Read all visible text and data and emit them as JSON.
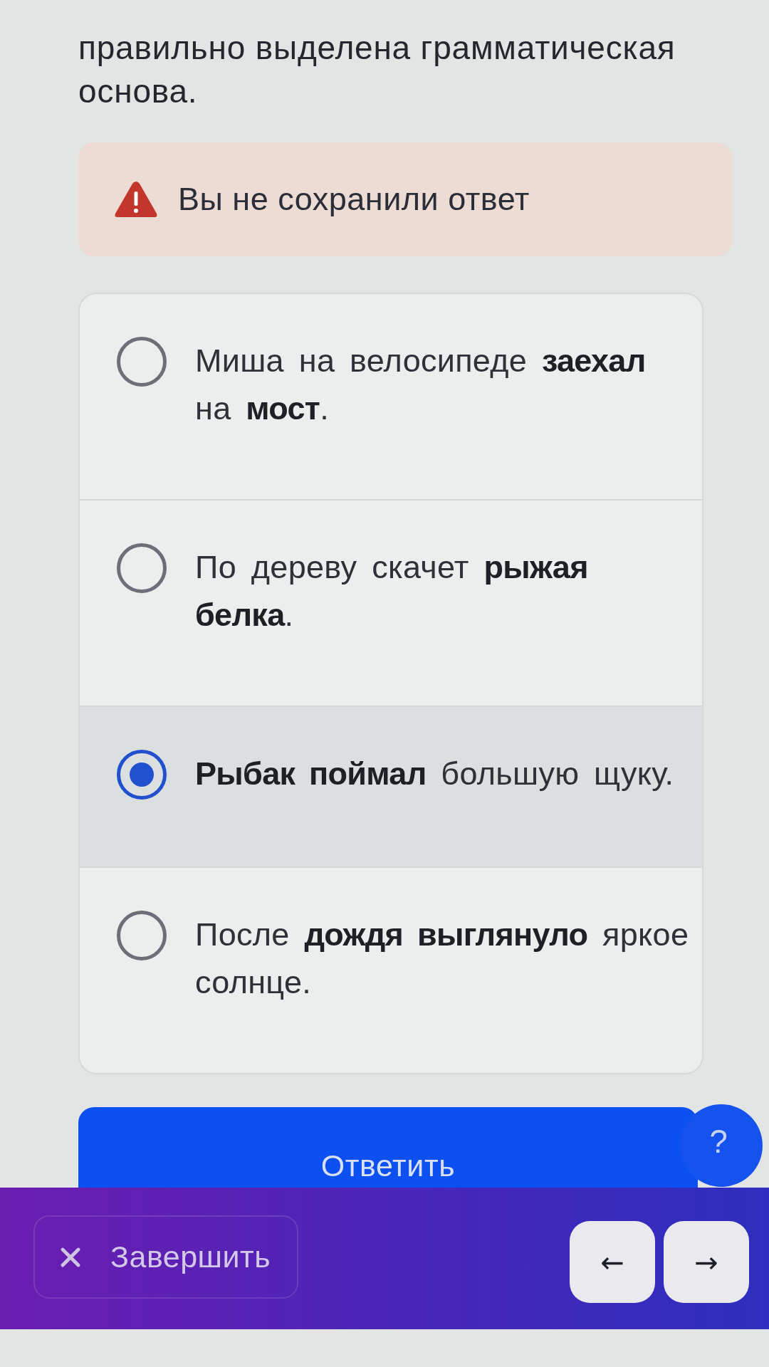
{
  "question": {
    "text": "правильно выделена грамматическая основа."
  },
  "alert": {
    "text": "Вы не сохранили ответ"
  },
  "options": [
    {
      "text": "Миша на велосипеде **заехал** на **мост**.",
      "selected": false
    },
    {
      "text": "По дереву скачет **рыжая белка**.",
      "selected": false
    },
    {
      "text": "**Рыбак поймал** большую щуку.",
      "selected": true
    },
    {
      "text": "После **дождя выглянуло** яркое солнце.",
      "selected": false
    }
  ],
  "answer_button": {
    "label": "Ответить"
  },
  "help_button": {
    "label": "?"
  },
  "bottom_bar": {
    "finish_button": {
      "label": "Завершить"
    },
    "prev_button": {
      "label": "←"
    },
    "next_button": {
      "label": "→"
    }
  }
}
